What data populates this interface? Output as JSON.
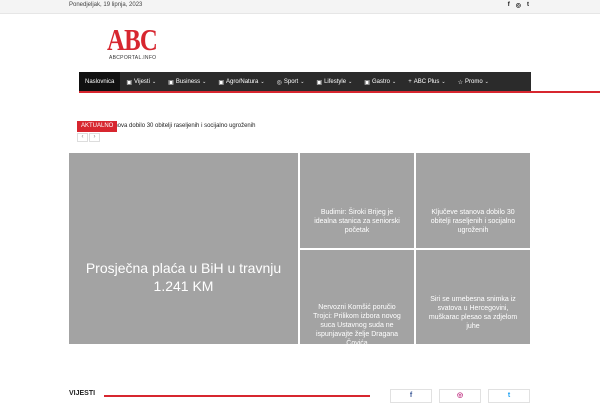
{
  "topbar": {
    "date": "Ponedjeljak, 19 lipnja, 2023",
    "social": [
      "f",
      "◎",
      "t"
    ]
  },
  "logo": {
    "text": "ABC",
    "subtitle": "ABCPORTAL.INFO"
  },
  "nav": {
    "items": [
      {
        "icon": "",
        "label": "Naslovnica",
        "chevron": ""
      },
      {
        "icon": "▣",
        "label": "Vijesti",
        "chevron": "⌄"
      },
      {
        "icon": "▣",
        "label": "Business",
        "chevron": "⌄"
      },
      {
        "icon": "▣",
        "label": "Agro/Natura",
        "chevron": "⌄"
      },
      {
        "icon": "◎",
        "label": "Sport",
        "chevron": "⌄"
      },
      {
        "icon": "▣",
        "label": "Lifestyle",
        "chevron": "⌄"
      },
      {
        "icon": "▣",
        "label": "Gastro",
        "chevron": "⌄"
      },
      {
        "icon": "+",
        "label": "ABC Plus",
        "chevron": "⌄"
      },
      {
        "icon": "☆",
        "label": "Promo",
        "chevron": "⌄"
      }
    ]
  },
  "ticker": {
    "badge": "AKTUALNO",
    "text": "...anova dobilo 30 obitelji raseljenih i socijalno ugroženih",
    "prev": "‹",
    "next": "›"
  },
  "tiles": {
    "big": "Prosječna plaća u BiH u travnju 1.241 KM",
    "t1": "Budimir: Široki Brijeg je idealna stanica za seniorski početak",
    "t2": "Ključeve stanova dobilo 30 obitelji raseljenih i socijalno ugroženih",
    "t3": "Nervozni Komšić poručio Trojci: Prilikom izbora novog suca Ustavnog suda ne ispunjavajte želje Dragana Čovića",
    "t4": "Siri se urnebesna snimka iz svatova u Hercegovini, muškarac plesao sa zdjelom juhe"
  },
  "section": {
    "title": "VIJESTI"
  },
  "social_boxes": [
    "f",
    "◎",
    "t"
  ],
  "colors": {
    "accent": "#d7262f",
    "nav_bg": "#2b2b2b",
    "tile_bg": "#a3a3a3"
  }
}
